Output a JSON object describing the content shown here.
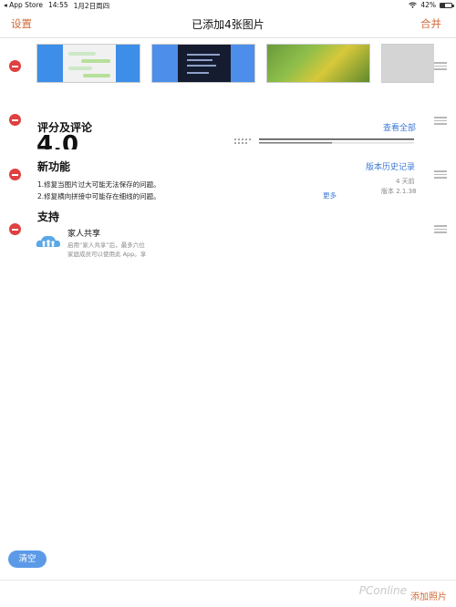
{
  "status_bar": {
    "back_app": "◂ App Store",
    "time": "14:55",
    "date": "1月2日周四",
    "wifi_icon": "wifi-icon",
    "battery_percent": "42%",
    "battery_level": 0.42
  },
  "nav": {
    "left_label": "设置",
    "title": "已添加4张图片",
    "right_label": "合并"
  },
  "rows": {
    "screenshots": {
      "thumbnails": [
        "screenshot-1",
        "screenshot-2",
        "photo-3",
        "screenshot-4"
      ]
    },
    "ratings": {
      "title": "评分及评论",
      "see_all": "查看全部",
      "big_rating_fragment": "4.0"
    },
    "whats_new": {
      "title": "新功能",
      "history_link": "版本历史记录",
      "note_1": "1.修复当图片过大可能无法保存的问题。",
      "note_2": "2.修复横向拼接中可能存在细线的问题。",
      "more": "更多",
      "age": "4 天前",
      "version": "版本 2.1.38"
    },
    "support": {
      "title": "支持",
      "family_title": "家人共享",
      "family_desc_1": "启用“家人共享”后，最多六位",
      "family_desc_2": "家庭成员可以使用此 App。享"
    }
  },
  "bottom": {
    "clear_label": "清空",
    "add_label": "添加照片",
    "watermark": "PConline"
  },
  "colors": {
    "accent_orange": "#d06b3a",
    "link_blue": "#3d7ad6",
    "delete_red": "#e04040",
    "clear_button": "#5c9ae8"
  }
}
